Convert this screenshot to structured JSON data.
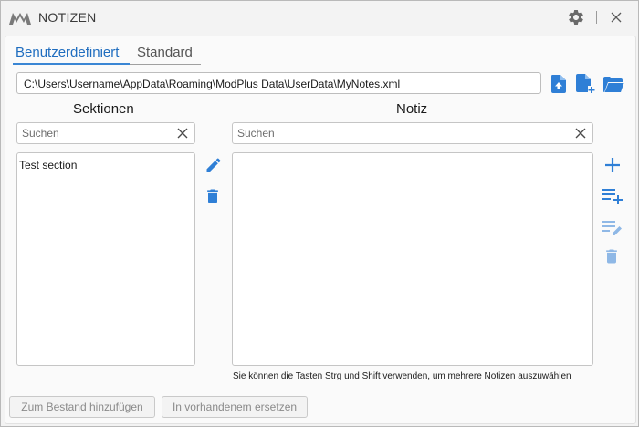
{
  "window": {
    "title": "NOTIZEN"
  },
  "tabs": [
    {
      "label": "Benutzerdefiniert",
      "active": true
    },
    {
      "label": "Standard",
      "active": false
    }
  ],
  "file": {
    "path": "C:\\Users\\Username\\AppData\\Roaming\\ModPlus Data\\UserData\\MyNotes.xml"
  },
  "sections": {
    "heading": "Sektionen",
    "search_placeholder": "Suchen",
    "items": [
      {
        "label": "Test section"
      }
    ]
  },
  "notes": {
    "heading": "Notiz",
    "search_placeholder": "Suchen",
    "hint": "Sie können die Tasten Strg und Shift verwenden, um mehrere Notizen auszuwählen"
  },
  "buttons": {
    "add_to_existing": "Zum Bestand hinzufügen",
    "replace_existing": "In vorhandenem ersetzen"
  },
  "colors": {
    "accent": "#1f6dbf",
    "icon_blue": "#2f7fd6",
    "icon_disabled": "#8fb8e6"
  },
  "icons": [
    "app-logo-icon",
    "settings-gear-icon",
    "close-icon",
    "upload-file-icon",
    "new-file-icon",
    "open-folder-icon",
    "edit-pencil-icon",
    "delete-trash-icon",
    "add-plus-icon",
    "add-list-icon",
    "edit-list-icon",
    "clear-search-icon"
  ]
}
